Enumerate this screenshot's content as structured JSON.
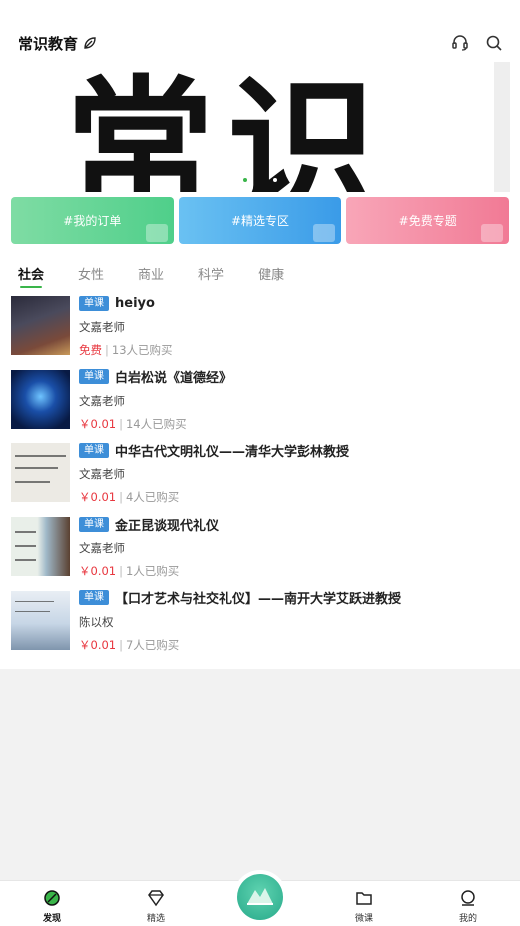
{
  "app": {
    "title": "常识教育"
  },
  "banner": {
    "text": "常识"
  },
  "quick_links": [
    {
      "label": "#我的订单"
    },
    {
      "label": "#精选专区"
    },
    {
      "label": "#免费专题"
    }
  ],
  "tabs": [
    {
      "label": "社会",
      "active": true
    },
    {
      "label": "女性"
    },
    {
      "label": "商业"
    },
    {
      "label": "科学"
    },
    {
      "label": "健康"
    }
  ],
  "courses": [
    {
      "badge": "单课",
      "title": "heiyo",
      "teacher": "文嘉老师",
      "price": "免费",
      "buyers": "13人已购买"
    },
    {
      "badge": "单课",
      "title": "白岩松说《道德经》",
      "teacher": "文嘉老师",
      "price": "￥0.01",
      "buyers": "14人已购买"
    },
    {
      "badge": "单课",
      "title": "中华古代文明礼仪——清华大学彭林教授",
      "teacher": "文嘉老师",
      "price": "￥0.01",
      "buyers": "4人已购买"
    },
    {
      "badge": "单课",
      "title": "金正昆谈现代礼仪",
      "teacher": "文嘉老师",
      "price": "￥0.01",
      "buyers": "1人已购买"
    },
    {
      "badge": "单课",
      "title": "【口才艺术与社交礼仪】——南开大学艾跃进教授",
      "teacher": "陈以权",
      "price": "￥0.01",
      "buyers": "7人已购买"
    }
  ],
  "bottom_nav": [
    {
      "label": "发现",
      "icon": "discover-icon",
      "active": true
    },
    {
      "label": "精选",
      "icon": "diamond-icon"
    },
    {
      "label": "",
      "icon": "center-logo-icon"
    },
    {
      "label": "微课",
      "icon": "folder-icon"
    },
    {
      "label": "我的",
      "icon": "profile-icon"
    }
  ],
  "colors": {
    "accent": "#3ab54a",
    "price": "#e8373f",
    "badge": "#3d8ed8"
  }
}
